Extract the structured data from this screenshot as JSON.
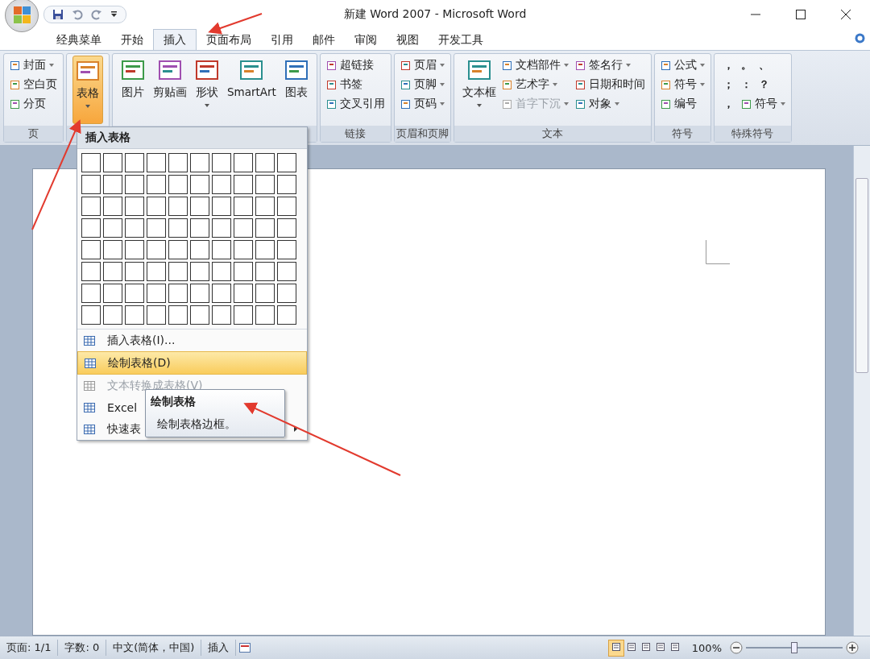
{
  "window": {
    "title": "新建 Word 2007 - Microsoft Word"
  },
  "tabs": [
    {
      "label": "经典菜单",
      "selected": false
    },
    {
      "label": "开始",
      "selected": false
    },
    {
      "label": "插入",
      "selected": true
    },
    {
      "label": "页面布局",
      "selected": false
    },
    {
      "label": "引用",
      "selected": false
    },
    {
      "label": "邮件",
      "selected": false
    },
    {
      "label": "审阅",
      "selected": false
    },
    {
      "label": "视图",
      "selected": false
    },
    {
      "label": "开发工具",
      "selected": false
    }
  ],
  "ribbon": {
    "groups": [
      {
        "label": "页",
        "items": [
          {
            "kind": "small",
            "label": "封面",
            "dropdown": true,
            "disabled": false,
            "selected": false
          },
          {
            "kind": "small",
            "label": "空白页",
            "dropdown": false,
            "disabled": false,
            "selected": false
          },
          {
            "kind": "small",
            "label": "分页",
            "dropdown": false,
            "disabled": false,
            "selected": false
          }
        ]
      },
      {
        "items": [
          {
            "kind": "large",
            "label": "表格",
            "dropdown": true,
            "disabled": false,
            "selected": true
          }
        ]
      },
      {
        "items": [
          {
            "kind": "large",
            "label": "图片",
            "dropdown": false,
            "disabled": false,
            "selected": false
          },
          {
            "kind": "large",
            "label": "剪贴画",
            "dropdown": false,
            "disabled": false,
            "selected": false
          },
          {
            "kind": "large",
            "label": "形状",
            "dropdown": true,
            "disabled": false,
            "selected": false
          },
          {
            "kind": "large",
            "label": "SmartArt",
            "dropdown": false,
            "disabled": false,
            "selected": false
          },
          {
            "kind": "large",
            "label": "图表",
            "dropdown": false,
            "disabled": false,
            "selected": false
          }
        ]
      },
      {
        "label": "链接",
        "items": [
          {
            "kind": "small",
            "label": "超链接",
            "dropdown": false,
            "disabled": false,
            "selected": false
          },
          {
            "kind": "small",
            "label": "书签",
            "dropdown": false,
            "disabled": false,
            "selected": false
          },
          {
            "kind": "small",
            "label": "交叉引用",
            "dropdown": false,
            "disabled": false,
            "selected": false
          }
        ]
      },
      {
        "label": "页眉和页脚",
        "items": [
          {
            "kind": "small",
            "label": "页眉",
            "dropdown": true,
            "disabled": false,
            "selected": false
          },
          {
            "kind": "small",
            "label": "页脚",
            "dropdown": true,
            "disabled": false,
            "selected": false
          },
          {
            "kind": "small",
            "label": "页码",
            "dropdown": true,
            "disabled": false,
            "selected": false
          }
        ]
      },
      {
        "label": "文本",
        "items": [
          {
            "kind": "large",
            "label": "文本框",
            "dropdown": true,
            "disabled": false,
            "selected": false
          },
          {
            "kind": "small",
            "label": "文档部件",
            "dropdown": true,
            "disabled": false,
            "selected": false
          },
          {
            "kind": "small",
            "label": "艺术字",
            "dropdown": true,
            "disabled": false,
            "selected": false
          },
          {
            "kind": "small",
            "label": "首字下沉",
            "dropdown": true,
            "disabled": true,
            "selected": false
          },
          {
            "kind": "small",
            "label": "签名行",
            "dropdown": true,
            "disabled": false,
            "selected": false
          },
          {
            "kind": "small",
            "label": "日期和时间",
            "dropdown": false,
            "disabled": false,
            "selected": false
          },
          {
            "kind": "small",
            "label": "对象",
            "dropdown": true,
            "disabled": false,
            "selected": false
          }
        ]
      },
      {
        "label": "符号",
        "items": [
          {
            "kind": "small",
            "label": "公式",
            "dropdown": true,
            "disabled": false,
            "selected": false
          },
          {
            "kind": "small",
            "label": "符号",
            "dropdown": true,
            "disabled": false,
            "selected": false
          },
          {
            "kind": "small",
            "label": "编号",
            "dropdown": false,
            "disabled": false,
            "selected": false
          }
        ]
      },
      {
        "label": "特殊符号",
        "items": [
          {
            "kind": "glyph",
            "label": "，",
            "disabled": false,
            "selected": false
          },
          {
            "kind": "glyph",
            "label": "。",
            "disabled": false,
            "selected": false
          },
          {
            "kind": "glyph",
            "label": "、",
            "disabled": false,
            "selected": false
          },
          {
            "kind": "glyph",
            "label": "；",
            "disabled": false,
            "selected": false
          },
          {
            "kind": "glyph",
            "label": "：",
            "disabled": false,
            "selected": false
          },
          {
            "kind": "glyph",
            "label": "？",
            "disabled": false,
            "selected": false
          },
          {
            "kind": "glyph",
            "label": "，",
            "disabled": false,
            "selected": false
          },
          {
            "kind": "small",
            "label": "符号",
            "dropdown": true,
            "disabled": false,
            "selected": false
          }
        ]
      }
    ]
  },
  "table_menu": {
    "title": "插入表格",
    "items": [
      {
        "label": "插入表格(I)...",
        "selected": false,
        "disabled": false,
        "submenu": false
      },
      {
        "label": "绘制表格(D)",
        "selected": true,
        "disabled": false,
        "submenu": false
      },
      {
        "label": "文本转换成表格(V)",
        "selected": false,
        "disabled": true,
        "submenu": false
      },
      {
        "label": "Excel",
        "selected": false,
        "disabled": false,
        "submenu": false
      },
      {
        "label": "快速表",
        "selected": false,
        "disabled": false,
        "submenu": true
      }
    ]
  },
  "tooltip": {
    "title": "绘制表格",
    "text": "绘制表格边框。"
  },
  "status_bar": {
    "items": [
      "页面: 1/1",
      "字数: 0",
      "中文(简体，中国)",
      "插入"
    ],
    "views": [
      {
        "selected": true
      },
      {
        "selected": false
      },
      {
        "selected": false
      },
      {
        "selected": false
      },
      {
        "selected": false
      }
    ],
    "zoom": "100%",
    "zoom_slider": {
      "level": 0.5
    }
  }
}
